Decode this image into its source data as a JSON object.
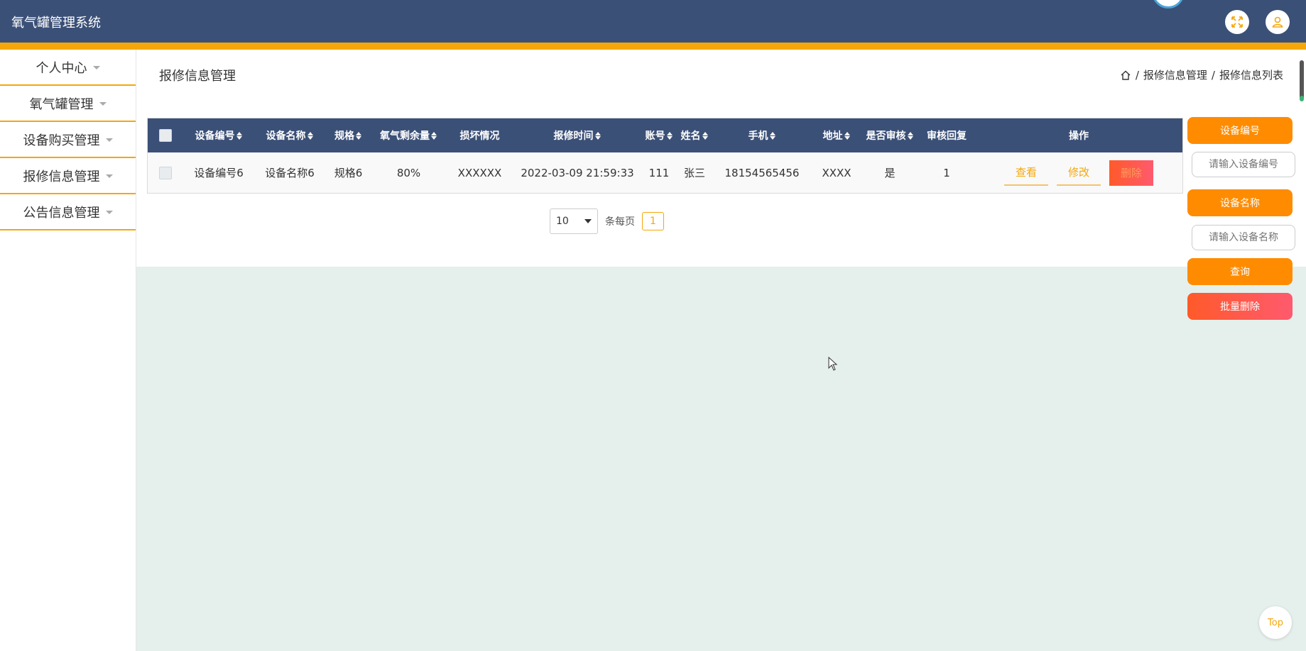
{
  "header": {
    "title": "氧气罐管理系统"
  },
  "sidebar": {
    "items": [
      {
        "label": "个人中心"
      },
      {
        "label": "氧气罐管理"
      },
      {
        "label": "设备购买管理"
      },
      {
        "label": "报修信息管理"
      },
      {
        "label": "公告信息管理"
      }
    ]
  },
  "page": {
    "title": "报修信息管理",
    "breadcrumb": {
      "sep": "/",
      "level1": "报修信息管理",
      "level2": "报修信息列表"
    }
  },
  "table": {
    "headers": [
      "设备编号",
      "设备名称",
      "规格",
      "氧气剩余量",
      "损坏情况",
      "报修时间",
      "账号",
      "姓名",
      "手机",
      "地址",
      "是否审核",
      "审核回复",
      "操作"
    ],
    "rows": [
      {
        "device_no": "设备编号6",
        "device_name": "设备名称6",
        "spec": "规格6",
        "oxygen": "80%",
        "damage": "XXXXXX",
        "time": "2022-03-09 21:59:33",
        "account": "111",
        "name": "张三",
        "phone": "18154565456",
        "address": "XXXX",
        "audited": "是",
        "reply": "1"
      }
    ],
    "actions": {
      "view": "查看",
      "edit": "修改",
      "delete": "删除"
    }
  },
  "pagination": {
    "page_size": "10",
    "per_page_label": "条每页",
    "current": "1"
  },
  "search": {
    "device_no_label": "设备编号",
    "device_no_placeholder": "请输入设备编号",
    "device_name_label": "设备名称",
    "device_name_placeholder": "请输入设备名称",
    "query": "查询",
    "batch_delete": "批量删除"
  },
  "top_button": "Top",
  "colors": {
    "header": "#3b5077",
    "accent": "#f5a70a",
    "button": "#ff8c00",
    "danger": "#ff5a4a",
    "content_bg": "#e5f0ec"
  }
}
